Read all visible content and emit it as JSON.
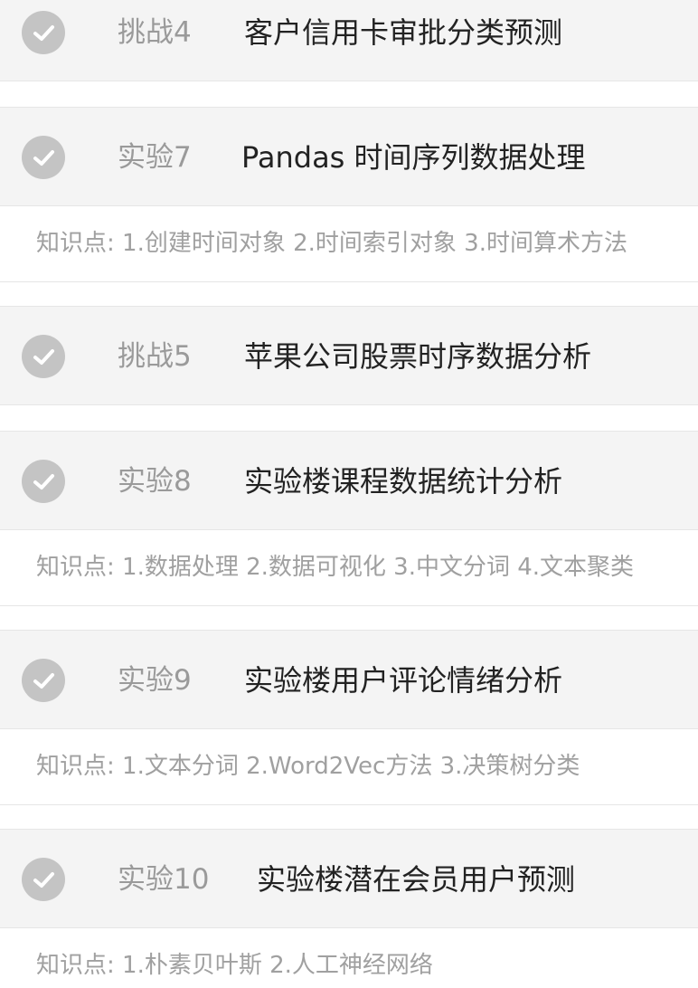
{
  "items": [
    {
      "kind": "挑战4",
      "title": "客户信用卡审批分类预测",
      "knowledge": ""
    },
    {
      "kind": "实验7",
      "title": "Pandas 时间序列数据处理",
      "knowledge": "知识点: 1.创建时间对象 2.时间索引对象 3.时间算术方法"
    },
    {
      "kind": "挑战5",
      "title": "苹果公司股票时序数据分析",
      "knowledge": ""
    },
    {
      "kind": "实验8",
      "title": "实验楼课程数据统计分析",
      "knowledge": "知识点: 1.数据处理 2.数据可视化 3.中文分词 4.文本聚类"
    },
    {
      "kind": "实验9",
      "title": "实验楼用户评论情绪分析",
      "knowledge": "知识点: 1.文本分词 2.Word2Vec方法 3.决策树分类"
    },
    {
      "kind": "实验10",
      "title": "实验楼潜在会员用户预测",
      "knowledge": "知识点: 1.朴素贝叶斯 2.人工神经网络"
    }
  ],
  "colors": {
    "header_bg": "#f4f4f4",
    "check_bg": "#c4c4c4",
    "kind_text": "#9a9a9a",
    "title_text": "#222222",
    "knowledge_text": "#a0a0a0"
  },
  "icons": {
    "status": "check-circle-icon"
  }
}
